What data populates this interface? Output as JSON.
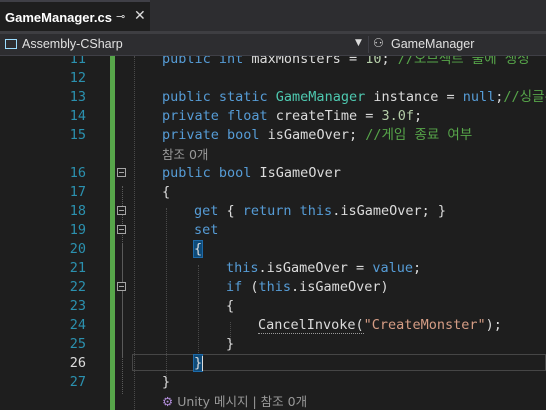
{
  "tab": {
    "title": "GameManager.cs",
    "pin_glyph": "⊸",
    "close_glyph": "✕"
  },
  "navbar": {
    "project": "Assembly-CSharp",
    "dropdown_glyph": "▼",
    "class_name": "GameManager"
  },
  "lines": [
    {
      "number": "11",
      "segments": [
        [
          "kw",
          "public int "
        ],
        [
          "tx",
          "maxMonsters = "
        ],
        [
          "nm",
          "10"
        ],
        [
          "tx",
          "; "
        ],
        [
          "cm",
          "//오브젝트 풀에 생성"
        ]
      ]
    },
    {
      "number": "12",
      "segments": []
    },
    {
      "number": "13",
      "segments": [
        [
          "kw",
          "public static "
        ],
        [
          "ty",
          "GameManager"
        ],
        [
          "tx",
          " instance = "
        ],
        [
          "kw",
          "null"
        ],
        [
          "tx",
          ";"
        ],
        [
          "cm",
          "//싱글톤"
        ]
      ]
    },
    {
      "number": "14",
      "segments": [
        [
          "kw",
          "private float "
        ],
        [
          "tx",
          "createTime = "
        ],
        [
          "nm",
          "3.0f"
        ],
        [
          "tx",
          ";"
        ]
      ]
    },
    {
      "number": "15",
      "segments": [
        [
          "kw",
          "private bool "
        ],
        [
          "tx",
          "isGameOver; "
        ],
        [
          "cm",
          "//게임 종료 여부"
        ]
      ]
    },
    {
      "number": "16",
      "segments": [
        [
          "kw",
          "public bool "
        ],
        [
          "tx",
          "IsGameOver"
        ]
      ]
    },
    {
      "number": "17",
      "segments": [
        [
          "tx",
          "{"
        ]
      ]
    },
    {
      "number": "18",
      "segments": [
        [
          "kw",
          "get"
        ],
        [
          "tx",
          " { "
        ],
        [
          "kw",
          "return this"
        ],
        [
          "tx",
          ".isGameOver; }"
        ]
      ]
    },
    {
      "number": "19",
      "segments": [
        [
          "kw",
          "set"
        ]
      ]
    },
    {
      "number": "20",
      "segments": [
        [
          "tx",
          "{"
        ]
      ]
    },
    {
      "number": "21",
      "segments": [
        [
          "kw",
          "this"
        ],
        [
          "tx",
          ".isGameOver = "
        ],
        [
          "kw",
          "value"
        ],
        [
          "tx",
          ";"
        ]
      ]
    },
    {
      "number": "22",
      "segments": [
        [
          "kw",
          "if"
        ],
        [
          "tx",
          " ("
        ],
        [
          "kw",
          "this"
        ],
        [
          "tx",
          ".isGameOver)"
        ]
      ]
    },
    {
      "number": "23",
      "segments": [
        [
          "tx",
          "{"
        ]
      ]
    },
    {
      "number": "24",
      "segments": [
        [
          "tx",
          "CancelInvoke("
        ],
        [
          "st",
          "\"CreateMonster\""
        ],
        [
          "tx",
          ");"
        ]
      ]
    },
    {
      "number": "25",
      "segments": [
        [
          "tx",
          "}"
        ]
      ]
    },
    {
      "number": "26",
      "segments": [
        [
          "tx",
          "}"
        ]
      ]
    },
    {
      "number": "27",
      "segments": [
        [
          "tx",
          "}"
        ]
      ]
    }
  ],
  "codelens": {
    "references_1": "참조 0개",
    "unity_message": "Unity 메시지 | 참조 0개",
    "unity_icon": "unity-icon"
  },
  "current_line": "26",
  "colors": {
    "keyword": "#569cd6",
    "type": "#4ec9b0",
    "string": "#d69d85",
    "comment": "#57a64a",
    "line_number": "#2b91af",
    "change_bar": "#57a64a"
  }
}
